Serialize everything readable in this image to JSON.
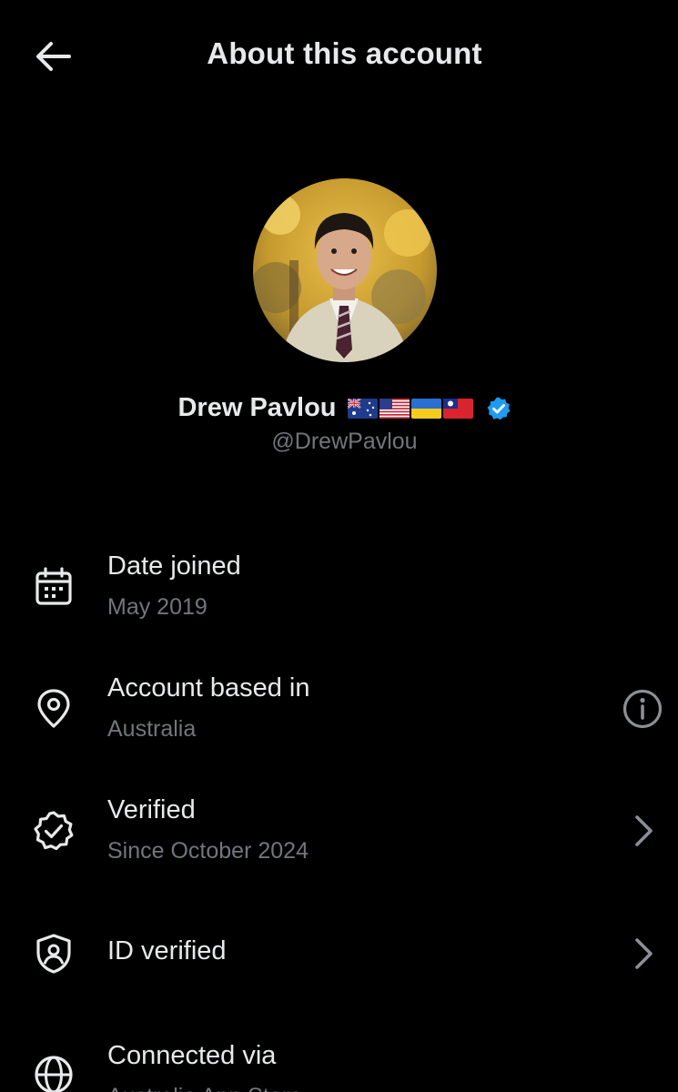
{
  "header": {
    "title": "About this account",
    "back_icon": "arrow-left-icon"
  },
  "profile": {
    "display_name": "Drew Pavlou",
    "handle": "@DrewPavlou",
    "flags": [
      "australia-flag",
      "usa-flag",
      "ukraine-flag",
      "taiwan-flag"
    ],
    "verified_badge": "verified-badge-icon",
    "badge_color": "#1d9bf0"
  },
  "details": [
    {
      "icon": "calendar-icon",
      "title": "Date joined",
      "subtitle": "May 2019",
      "trailing": ""
    },
    {
      "icon": "location-pin-icon",
      "title": "Account based in",
      "subtitle": "Australia",
      "trailing": "info-icon"
    },
    {
      "icon": "verified-check-icon",
      "title": "Verified",
      "subtitle": "Since October 2024",
      "trailing": "chevron-right-icon"
    },
    {
      "icon": "id-shield-icon",
      "title": "ID verified",
      "subtitle": "",
      "trailing": "chevron-right-icon"
    },
    {
      "icon": "globe-icon",
      "title": "Connected via",
      "subtitle": "Australia App Store",
      "trailing": ""
    }
  ],
  "colors": {
    "background": "#000000",
    "primary_text": "#e7e9ea",
    "secondary_text": "#71767b",
    "accent": "#1d9bf0"
  }
}
